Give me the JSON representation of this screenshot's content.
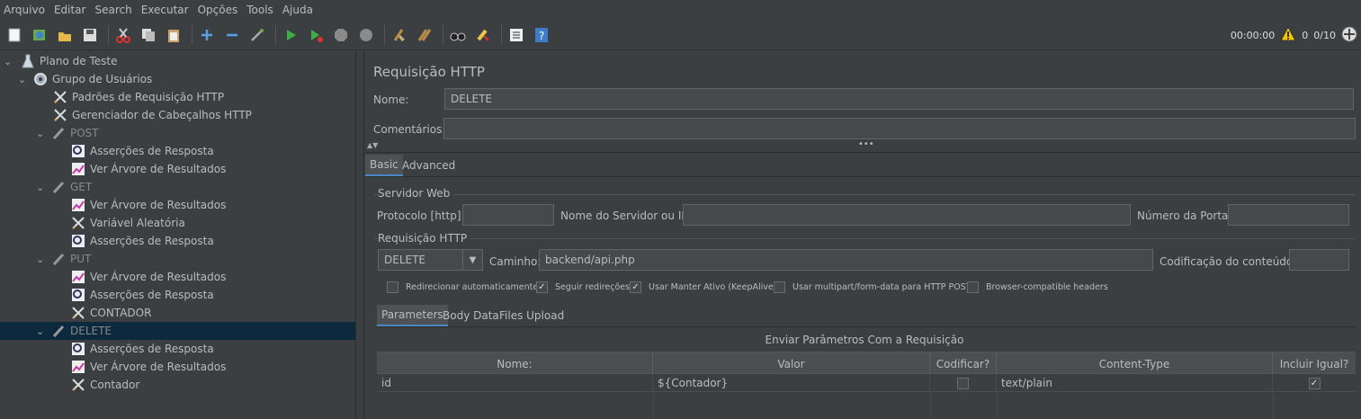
{
  "menu": [
    "Arquivo",
    "Editar",
    "Search",
    "Executar",
    "Opções",
    "Tools",
    "Ajuda"
  ],
  "toolbar": {
    "icons": [
      "new-icon",
      "templates-icon",
      "open-icon",
      "save-icon",
      "cut-icon",
      "copy-icon",
      "paste-icon",
      "expand-icon",
      "collapse-icon",
      "toggle-icon",
      "start-icon",
      "start-no-pause-icon",
      "stop-icon",
      "shutdown-icon",
      "clear-icon",
      "clear-all-icon",
      "search-icon",
      "reset-search-icon",
      "function-helper-icon",
      "help-icon"
    ],
    "timer": "00:00:00",
    "warnings": "0",
    "threads": "0/10"
  },
  "tree": [
    {
      "label": "Plano de Teste",
      "icon": "test-plan-icon",
      "level": 0,
      "expanded": true
    },
    {
      "label": "Grupo de Usuários",
      "icon": "thread-group-icon",
      "level": 1,
      "expanded": true
    },
    {
      "label": "Padrões de Requisição HTTP",
      "icon": "config-icon",
      "level": 2
    },
    {
      "label": "Gerenciador de Cabeçalhos HTTP",
      "icon": "config-icon",
      "level": 2
    },
    {
      "label": "POST",
      "icon": "sampler-icon",
      "level": 2,
      "expanded": true,
      "disabled": true
    },
    {
      "label": "Asserções de Resposta",
      "icon": "assertion-icon",
      "level": 3
    },
    {
      "label": "Ver Árvore de Resultados",
      "icon": "listener-icon",
      "level": 3
    },
    {
      "label": "GET",
      "icon": "sampler-icon",
      "level": 2,
      "expanded": true,
      "disabled": true
    },
    {
      "label": "Ver Árvore de Resultados",
      "icon": "listener-icon",
      "level": 3
    },
    {
      "label": "Variável Aleatória",
      "icon": "config-icon",
      "level": 3
    },
    {
      "label": "Asserções de Resposta",
      "icon": "assertion-icon",
      "level": 3
    },
    {
      "label": "PUT",
      "icon": "sampler-icon",
      "level": 2,
      "expanded": true,
      "disabled": true
    },
    {
      "label": "Ver Árvore de Resultados",
      "icon": "listener-icon",
      "level": 3
    },
    {
      "label": "Asserções de Resposta",
      "icon": "assertion-icon",
      "level": 3
    },
    {
      "label": "CONTADOR",
      "icon": "config-icon",
      "level": 3
    },
    {
      "label": "DELETE",
      "icon": "sampler-icon",
      "level": 2,
      "expanded": true,
      "disabled": true,
      "selected": true
    },
    {
      "label": "Asserções de Resposta",
      "icon": "assertion-icon",
      "level": 3
    },
    {
      "label": "Ver Árvore de Resultados",
      "icon": "listener-icon",
      "level": 3
    },
    {
      "label": "Contador",
      "icon": "config-icon",
      "level": 3
    }
  ],
  "panel": {
    "title": "Requisição HTTP",
    "name_label": "Nome:",
    "name_value": "DELETE",
    "comments_label": "Comentários:",
    "comments_value": "",
    "tabs": [
      "Basic",
      "Advanced"
    ],
    "server_section": "Servidor Web",
    "protocol_label": "Protocolo [http]:",
    "protocol_value": "",
    "server_label": "Nome do Servidor ou IP:",
    "server_value": "",
    "port_label": "Número da Porta:",
    "port_value": "",
    "request_section": "Requisição HTTP",
    "method": "DELETE",
    "path_label": "Caminho:",
    "path_value": "backend/api.php",
    "encoding_label": "Codificação do conteúdo:",
    "encoding_value": "",
    "checkboxes": [
      {
        "label": "Redirecionar automaticamente",
        "checked": false
      },
      {
        "label": "Seguir redireções",
        "checked": true
      },
      {
        "label": "Usar Manter Ativo (KeepAlive)",
        "checked": true
      },
      {
        "label": "Usar multipart/form-data para HTTP POST",
        "checked": false
      },
      {
        "label": "Browser-compatible headers",
        "checked": false
      }
    ],
    "subtabs": [
      "Parameters",
      "Body Data",
      "Files Upload"
    ],
    "params_title": "Enviar Parâmetros Com a Requisição",
    "columns": [
      "Nome:",
      "Valor",
      "Codificar?",
      "Content-Type",
      "Incluir Igual?"
    ],
    "rows": [
      {
        "name": "id",
        "value": "${Contador}",
        "encode": false,
        "content_type": "text/plain",
        "include_equals": true
      }
    ]
  }
}
